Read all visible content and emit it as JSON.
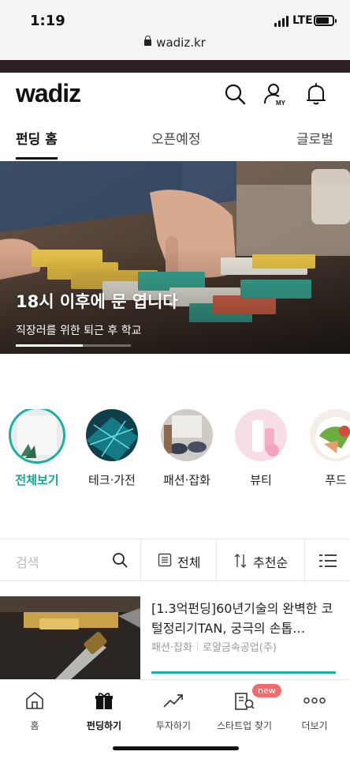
{
  "status_bar": {
    "time": "1:19",
    "network": "LTE",
    "url": "wadiz.kr"
  },
  "header": {
    "logo": "wadiz",
    "my_label": "MY",
    "icons": [
      "search-icon",
      "my-account-icon",
      "bell-icon"
    ]
  },
  "tabs": [
    {
      "label": "펀딩 홈",
      "active": true
    },
    {
      "label": "오픈예정",
      "active": false
    },
    {
      "label": "글로벌",
      "active": false
    }
  ],
  "hero": {
    "title": "18시 이후에 문 엽니다",
    "subtitle": "직장러를 위한 퇴근 후 학교",
    "progress": 0.58
  },
  "categories": [
    {
      "label": "전체보기",
      "active": true
    },
    {
      "label": "테크·가전",
      "active": false
    },
    {
      "label": "패션·잡화",
      "active": false
    },
    {
      "label": "뷰티",
      "active": false
    },
    {
      "label": "푸드",
      "active": false
    }
  ],
  "filter": {
    "search_placeholder": "검색",
    "category_label": "전체",
    "sort_label": "추천순"
  },
  "product": {
    "title": "[1.3억펀딩]60년기술의 완벽한 코털정리기TAN, 궁극의 손톱…",
    "category": "패션·잡화",
    "maker": "로얄금속공업(주)"
  },
  "bottom_nav": [
    {
      "label": "홈",
      "active": false
    },
    {
      "label": "펀딩하기",
      "active": true
    },
    {
      "label": "투자하기",
      "active": false
    },
    {
      "label": "스타트업 찾기",
      "active": false,
      "badge": "new"
    },
    {
      "label": "더보기",
      "active": false
    }
  ],
  "colors": {
    "accent": "#1ab0a4",
    "badge": "#f26a6a"
  }
}
